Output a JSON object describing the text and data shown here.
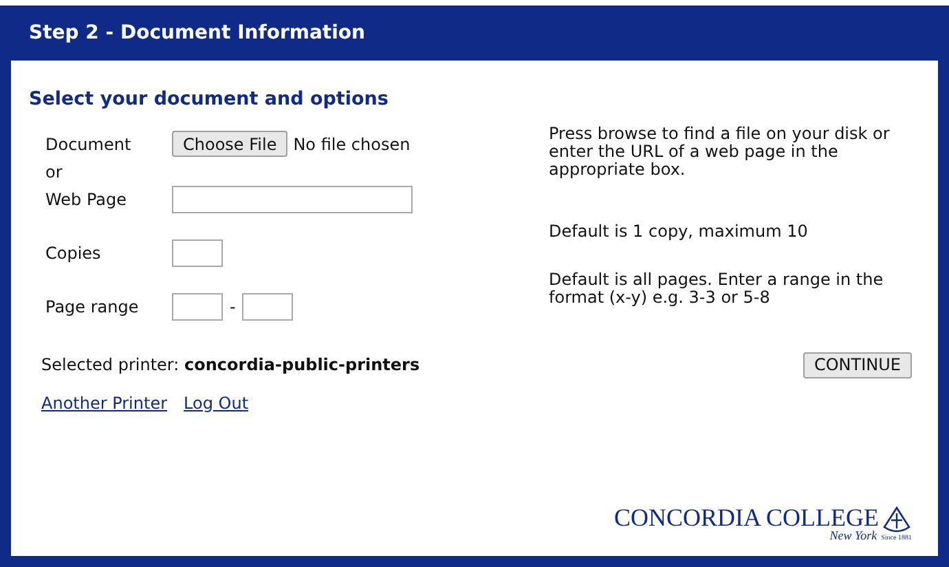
{
  "header": {
    "title": "Step 2 - Document Information"
  },
  "section_title": "Select your document and options",
  "rows": [
    {
      "kind": "file",
      "label": "Document",
      "button": "Choose File",
      "status": "No file chosen",
      "help": "Press browse to find a file on your disk or enter the URL of a web page in the appropriate box."
    },
    {
      "kind": "separator",
      "label": "or"
    },
    {
      "kind": "text",
      "label": "Web Page"
    },
    {
      "kind": "small",
      "label": "Copies",
      "help": "Default is 1 copy, maximum 10"
    },
    {
      "kind": "range",
      "label": "Page range",
      "separator": "-",
      "help": "Default is all pages. Enter a range in the format (x-y) e.g. 3-3 or 5-8"
    }
  ],
  "printer": {
    "label": "Selected printer:",
    "name": "concordia-public-printers"
  },
  "continue_button": "CONTINUE",
  "links": [
    "Another Printer",
    "Log Out"
  ],
  "logo": {
    "name": "CONCORDIA COLLEGE",
    "place": "New York",
    "since": "Since 1881"
  }
}
